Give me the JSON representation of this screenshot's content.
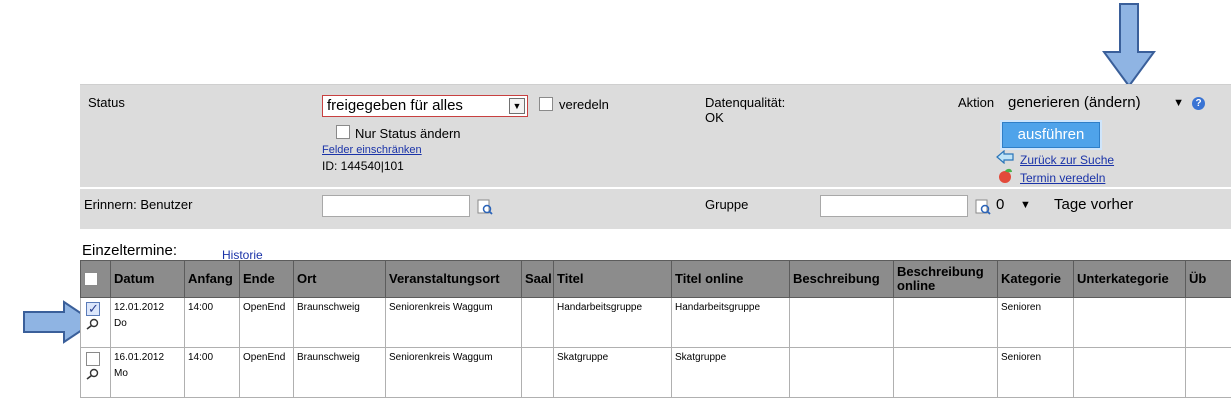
{
  "status": {
    "label": "Status",
    "select_value": "freigegeben für alles",
    "veredeln_label": "veredeln",
    "nur_status_label": "Nur Status ändern",
    "felder_link": "Felder einschränken",
    "id_text": "ID: 144540|101"
  },
  "quality": {
    "label": "Datenqualität:",
    "value": "OK"
  },
  "aktion": {
    "label": "Aktion",
    "select_value": "generieren (ändern)",
    "execute_label": "ausführen",
    "back_link": "Zurück zur Suche",
    "refine_link": "Termin veredeln"
  },
  "reminder": {
    "label": "Erinnern: Benutzer",
    "group_label": "Gruppe",
    "days_value": "0",
    "days_label": "Tage vorher"
  },
  "section": {
    "title": "Einzeltermine:",
    "history_link": "Historie"
  },
  "table": {
    "columns": [
      "",
      "Datum",
      "Anfang",
      "Ende",
      "Ort",
      "Veranstaltungsort",
      "Saal",
      "Titel",
      "Titel online",
      "Beschreibung",
      "Beschreibung online",
      "Kategorie",
      "Unterkategorie",
      "Üb"
    ],
    "rows": [
      {
        "checked": true,
        "date": "12.01.2012",
        "weekday": "Do",
        "start": "14:00",
        "end": "OpenEnd",
        "place": "Braunschweig",
        "venue": "Seniorenkreis Waggum",
        "room": "",
        "title": "Handarbeitsgruppe",
        "title_online": "Handarbeitsgruppe",
        "description": "",
        "description_online": "",
        "category": "Senioren",
        "subcategory": "",
        "ub": ""
      },
      {
        "checked": false,
        "date": "16.01.2012",
        "weekday": "Mo",
        "start": "14:00",
        "end": "OpenEnd",
        "place": "Braunschweig",
        "venue": "Seniorenkreis Waggum",
        "room": "",
        "title": "Skatgruppe",
        "title_online": "Skatgruppe",
        "description": "",
        "description_online": "",
        "category": "Senioren",
        "subcategory": "",
        "ub": ""
      }
    ]
  },
  "colors": {
    "panel_bg": "#dcdcdc",
    "header_bg": "#8c8c8c",
    "link": "#1a33a8",
    "button": "#4fa3ea",
    "arrow_fill": "#8fb4e3",
    "arrow_stroke": "#3a5f9a"
  }
}
